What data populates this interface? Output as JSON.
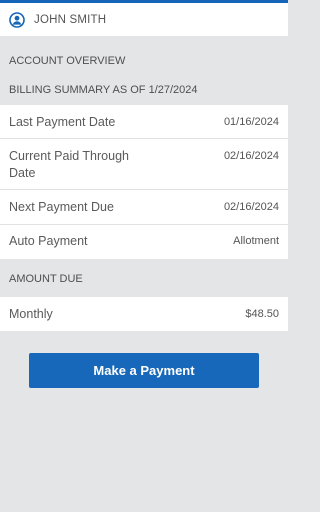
{
  "header": {
    "user_name": "JOHN SMITH",
    "accent_color": "#1565b8",
    "icon": "user-circle-icon"
  },
  "overview": {
    "title": "ACCOUNT OVERVIEW"
  },
  "billing": {
    "title": "BILLING SUMMARY AS OF 1/27/2024",
    "rows": [
      {
        "label": "Last Payment Date",
        "value": "01/16/2024"
      },
      {
        "label": "Current Paid Through Date",
        "value": "02/16/2024"
      },
      {
        "label": "Next Payment Due",
        "value": "02/16/2024"
      },
      {
        "label": "Auto Payment",
        "value": "Allotment"
      }
    ]
  },
  "amount_due": {
    "title": "AMOUNT DUE",
    "label": "Monthly",
    "value": "$48.50"
  },
  "actions": {
    "pay_label": "Make a Payment",
    "button_color": "#1768ba"
  }
}
